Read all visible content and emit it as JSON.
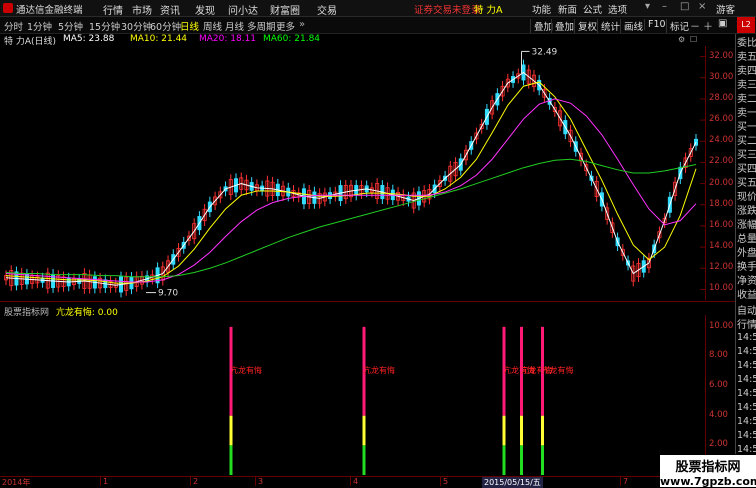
{
  "titlebar": {
    "app_title": "通达信金融终端",
    "menus": [
      "行情",
      "市场",
      "资讯",
      "发现",
      "问小达",
      "财富圈",
      "交易"
    ],
    "notice": "证券交易未登录",
    "stock": "特 力A",
    "right_menus": [
      "功能",
      "新面",
      "公式",
      "选项"
    ],
    "guest": "游客"
  },
  "timeframes": [
    "分时",
    "1分钟",
    "5分钟",
    "15分钟",
    "30分钟",
    "60分钟",
    "日线",
    "周线",
    "月线",
    "多周期",
    "更多"
  ],
  "active_tf": "日线",
  "toolbar_right": [
    "叠加",
    "叠加",
    "复权",
    "统计",
    "画线",
    "F10",
    "标记"
  ],
  "header": {
    "name": "特 力A",
    "period": "(日线)",
    "ma5": "MA5: 23.88",
    "ma10": "MA10: 21.44",
    "ma20": "MA20: 18.11",
    "ma60": "MA60: 21.84"
  },
  "price_axis": [
    "32.00",
    "30.00",
    "28.00",
    "26.00",
    "24.00",
    "22.00",
    "20.00",
    "18.00",
    "16.00",
    "14.00",
    "12.00",
    "10.00"
  ],
  "annotations": {
    "high": "32.49",
    "low": "9.70"
  },
  "indicator": {
    "title": "股票指标网",
    "name": "亢龙有悔: 0.00",
    "label": "亢龙有悔",
    "axis": [
      "10.00",
      "8.00",
      "6.00",
      "4.00",
      "2.00"
    ],
    "bar_labels": [
      "亢龙有悔",
      "亢龙有悔",
      "亢龙有悔",
      "亢龙有悔",
      "亢龙有悔"
    ]
  },
  "right_panel": {
    "top": [
      "委比",
      "卖五",
      "卖四",
      "卖三",
      "卖二",
      "卖一",
      "买一",
      "买二",
      "买三",
      "买四",
      "买五",
      "现价",
      "涨跌",
      "涨幅",
      "总量",
      "外盘",
      "换手",
      "净资",
      "收益"
    ],
    "auto": "自动",
    "quote": "行情",
    "times": [
      "14:5",
      "14:5",
      "14:5",
      "14:5",
      "14:5",
      "14:5",
      "14:5",
      "14:5",
      "14:5",
      "14:5"
    ]
  },
  "time_axis": {
    "year": "2014年",
    "ticks": [
      "1",
      "2",
      "3",
      "4",
      "5",
      "6",
      "7"
    ],
    "date": "2015/05/15/五"
  },
  "watermark": {
    "line1": "股票指标网",
    "line2": "www.7gpzb.com"
  },
  "chart_data": {
    "type": "candlestick",
    "ylim": [
      9,
      33
    ],
    "high": 32.49,
    "low": 9.7,
    "series": [
      {
        "name": "MA5",
        "color": "#ffffff",
        "values": [
          11.1,
          11.0,
          10.9,
          10.8,
          10.7,
          10.8,
          10.6,
          10.4,
          10.6,
          11.0,
          11.5,
          13.5,
          15.5,
          17.8,
          19.5,
          20.0,
          19.6,
          19.5,
          19.2,
          18.8,
          18.6,
          19.0,
          19.3,
          19.5,
          19.2,
          18.8,
          18.4,
          19.0,
          20.5,
          21.8,
          24.5,
          27.2,
          29.5,
          30.5,
          29.3,
          27.0,
          24.5,
          21.5,
          18.5,
          14.5,
          11.5,
          12.5,
          16.5,
          21.0,
          23.9
        ]
      },
      {
        "name": "MA10",
        "color": "#ffff00",
        "values": [
          11.3,
          11.2,
          11.1,
          11.0,
          10.9,
          10.9,
          10.8,
          10.6,
          10.6,
          10.8,
          11.2,
          12.2,
          13.8,
          15.8,
          17.6,
          18.9,
          19.3,
          19.3,
          19.2,
          19.0,
          18.8,
          18.8,
          18.9,
          19.1,
          19.1,
          19.0,
          18.8,
          18.8,
          19.5,
          20.6,
          22.3,
          24.8,
          27.4,
          29.2,
          29.6,
          28.2,
          26.1,
          23.2,
          20.3,
          17.1,
          14.2,
          12.8,
          14.0,
          17.0,
          21.4
        ]
      },
      {
        "name": "MA20",
        "color": "#ff33ff",
        "values": [
          11.5,
          11.4,
          11.3,
          11.2,
          11.1,
          11.0,
          10.9,
          10.8,
          10.7,
          10.7,
          10.9,
          11.4,
          12.3,
          13.5,
          15.0,
          16.4,
          17.5,
          18.2,
          18.6,
          18.8,
          18.9,
          18.9,
          18.9,
          18.9,
          18.9,
          18.9,
          18.9,
          18.9,
          19.2,
          19.8,
          20.8,
          22.3,
          24.2,
          26.1,
          27.5,
          28.0,
          27.6,
          26.4,
          24.6,
          22.3,
          19.9,
          17.6,
          16.1,
          16.5,
          18.1
        ]
      },
      {
        "name": "MA60",
        "color": "#22cc22",
        "values": [
          11.6,
          11.5,
          11.5,
          11.4,
          11.4,
          11.4,
          11.3,
          11.3,
          11.2,
          11.2,
          11.2,
          11.3,
          11.6,
          12.0,
          12.5,
          13.1,
          13.7,
          14.3,
          14.9,
          15.4,
          15.9,
          16.3,
          16.7,
          17.1,
          17.5,
          17.9,
          18.3,
          18.7,
          19.1,
          19.5,
          20.0,
          20.5,
          21.0,
          21.5,
          21.9,
          22.2,
          22.3,
          22.1,
          21.7,
          21.3,
          21.0,
          21.0,
          21.2,
          21.5,
          21.8
        ]
      }
    ],
    "signals": [
      0.33,
      0.52,
      0.72,
      0.745,
      0.775
    ]
  }
}
